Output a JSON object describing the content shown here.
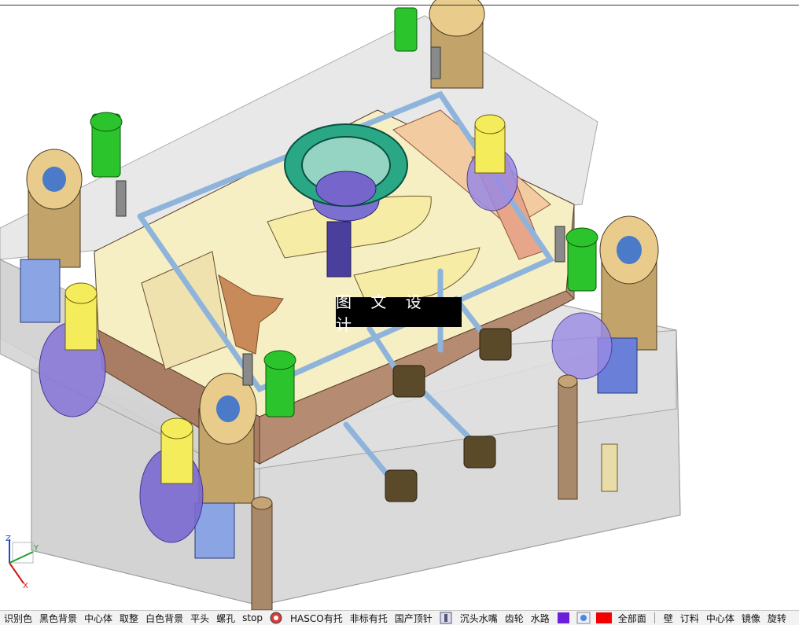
{
  "viewport": {
    "watermark": "图 文 设 计",
    "triad": {
      "x": "X",
      "y": "Y",
      "z": "Z"
    }
  },
  "toolbar": {
    "items": [
      "识别色",
      "黑色背景",
      "中心体",
      "取整",
      "白色背景",
      "平头",
      "螺孔",
      "stop",
      "HASCO有托",
      "非标有托",
      "国产顶针",
      "沉头水嘴",
      "齿轮",
      "水路",
      "全部面",
      "壁",
      "订料",
      "中心体",
      "镜像",
      "旋转"
    ],
    "colors": {
      "purple": "#6a1fd8",
      "red": "#f00000"
    }
  }
}
